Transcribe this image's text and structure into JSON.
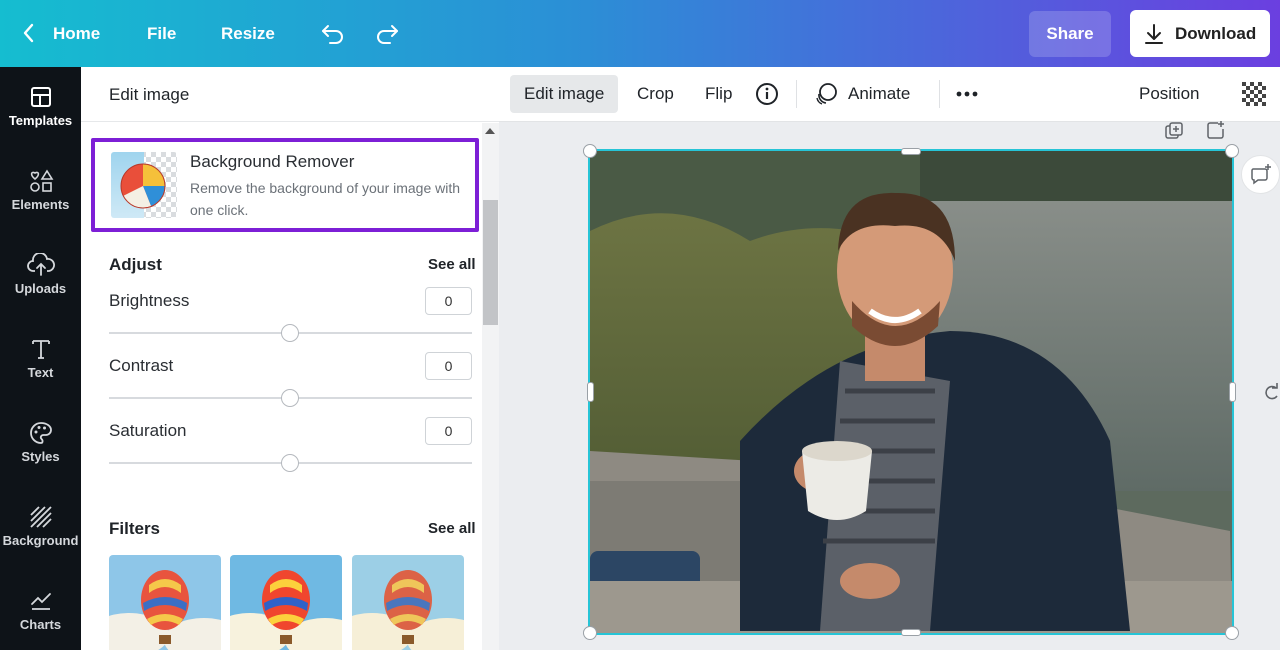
{
  "topbar": {
    "home_label": "Home",
    "file_label": "File",
    "resize_label": "Resize",
    "share_label": "Share",
    "download_label": "Download"
  },
  "rail": {
    "items": [
      {
        "label": "Templates",
        "icon": "templates-icon"
      },
      {
        "label": "Elements",
        "icon": "elements-icon"
      },
      {
        "label": "Uploads",
        "icon": "uploads-icon"
      },
      {
        "label": "Text",
        "icon": "text-icon"
      },
      {
        "label": "Styles",
        "icon": "styles-icon"
      },
      {
        "label": "Background",
        "icon": "background-icon"
      },
      {
        "label": "Charts",
        "icon": "charts-icon"
      }
    ]
  },
  "panel": {
    "title": "Edit image",
    "bg_remover": {
      "title": "Background Remover",
      "description": "Remove the background of your image with one click."
    },
    "adjust": {
      "title": "Adjust",
      "see_all": "See all",
      "sliders": [
        {
          "label": "Brightness",
          "value": "0"
        },
        {
          "label": "Contrast",
          "value": "0"
        },
        {
          "label": "Saturation",
          "value": "0"
        }
      ]
    },
    "filters": {
      "title": "Filters",
      "see_all": "See all"
    }
  },
  "context_toolbar": {
    "edit_image": "Edit image",
    "crop": "Crop",
    "flip": "Flip",
    "animate": "Animate",
    "position": "Position"
  },
  "colors": {
    "accent_purple": "#7d1fd6",
    "selection_cyan": "#26c4d6",
    "rail_bg": "#0e1318"
  }
}
